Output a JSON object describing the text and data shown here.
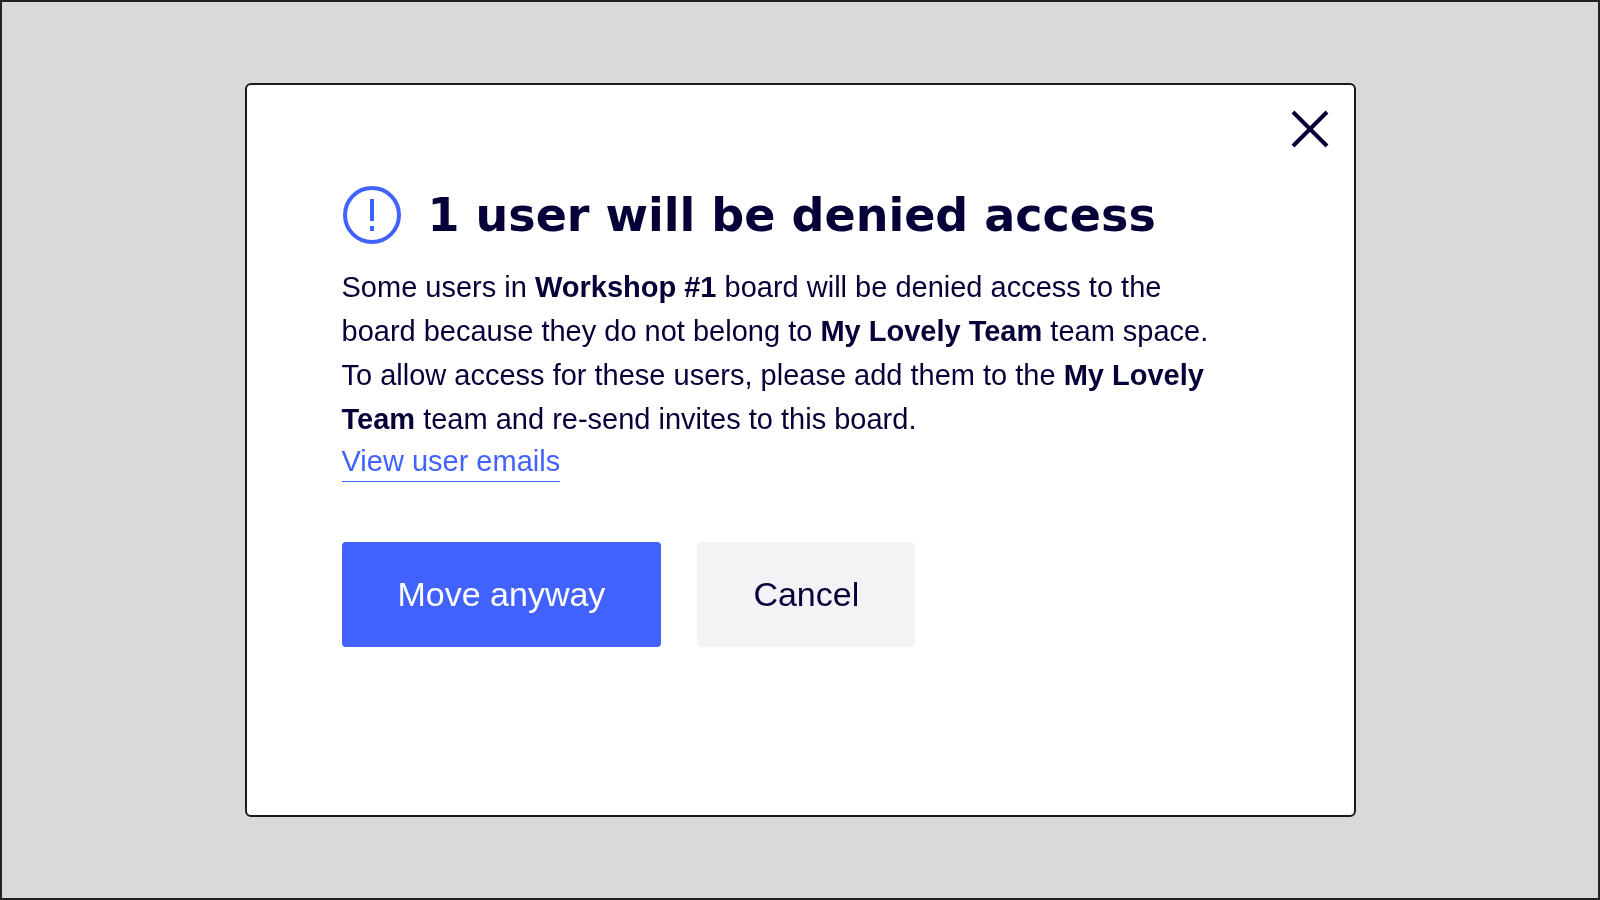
{
  "dialog": {
    "title": "1 user will be denied access",
    "message": "Some users in **Workshop #1** board will be denied access to the board because they do not belong to **My Lovely Team** team space. To allow access for these users, please add them to the **My Lovely Team** team and re-send invites to this board.",
    "link": "View user emails",
    "buttons": [
      {
        "label": "Move anyway",
        "kind": "primary"
      },
      {
        "label": "Cancel",
        "kind": "secondary"
      }
    ]
  }
}
